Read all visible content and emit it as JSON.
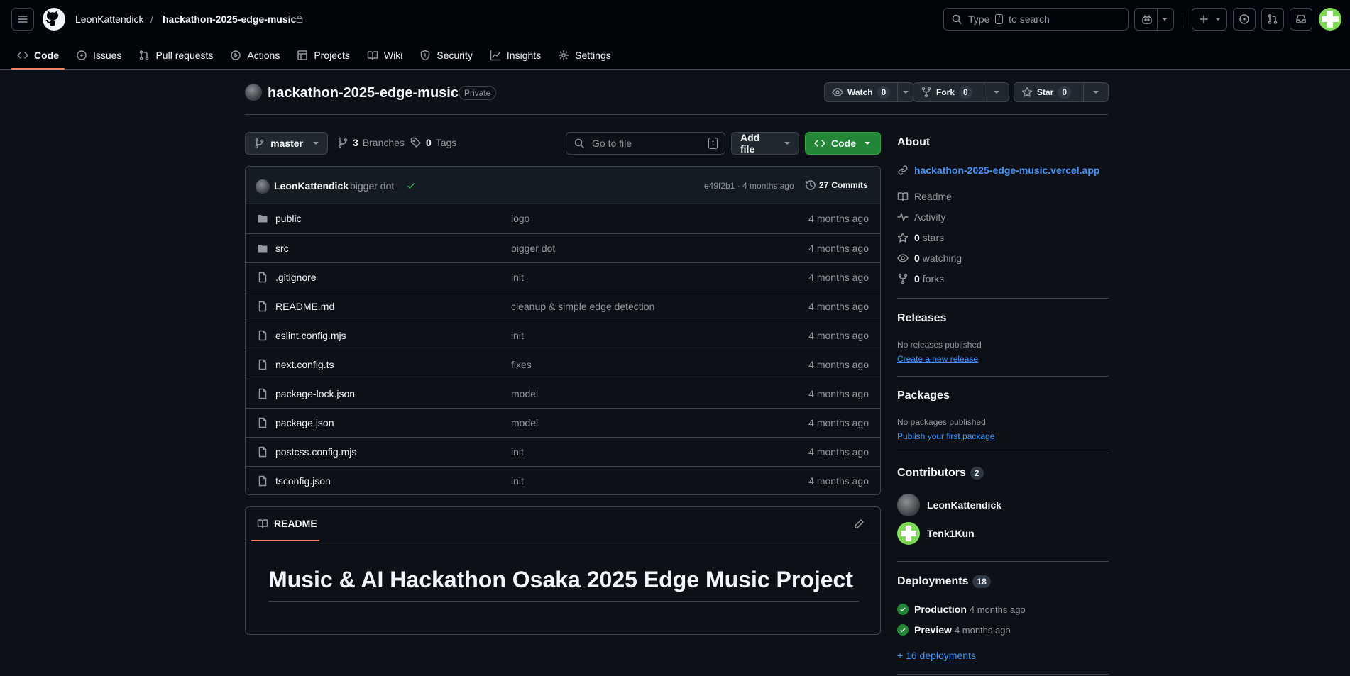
{
  "header": {
    "owner": "LeonKattendick",
    "separator": "/",
    "repo": "hackathon-2025-edge-music",
    "search_prefix": "Type",
    "search_key": "/",
    "search_suffix": "to search"
  },
  "tabs": [
    {
      "label": "Code",
      "icon": "code-icon"
    },
    {
      "label": "Issues",
      "icon": "issue-icon"
    },
    {
      "label": "Pull requests",
      "icon": "pull-request-icon"
    },
    {
      "label": "Actions",
      "icon": "play-icon"
    },
    {
      "label": "Projects",
      "icon": "table-icon"
    },
    {
      "label": "Wiki",
      "icon": "book-icon"
    },
    {
      "label": "Security",
      "icon": "shield-icon"
    },
    {
      "label": "Insights",
      "icon": "graph-icon"
    },
    {
      "label": "Settings",
      "icon": "gear-icon"
    }
  ],
  "repo": {
    "name": "hackathon-2025-edge-music",
    "visibility": "Private",
    "watch_label": "Watch",
    "watch_count": "0",
    "fork_label": "Fork",
    "fork_count": "0",
    "star_label": "Star",
    "star_count": "0"
  },
  "toolbar": {
    "branch": "master",
    "branches_count": "3",
    "branches_label": "Branches",
    "tags_count": "0",
    "tags_label": "Tags",
    "goto_placeholder": "Go to file",
    "goto_key": "t",
    "add_file": "Add file",
    "code": "Code"
  },
  "commit": {
    "author": "LeonKattendick",
    "message": "bigger dot",
    "hash_time": "e49f2b1 · 4 months ago",
    "commits_count": "27",
    "commits_label": "Commits"
  },
  "files": [
    {
      "name": "public",
      "type": "folder",
      "message": "logo",
      "date": "4 months ago"
    },
    {
      "name": "src",
      "type": "folder",
      "message": "bigger dot",
      "date": "4 months ago"
    },
    {
      "name": ".gitignore",
      "type": "file",
      "message": "init",
      "date": "4 months ago"
    },
    {
      "name": "README.md",
      "type": "file",
      "message": "cleanup & simple edge detection",
      "date": "4 months ago"
    },
    {
      "name": "eslint.config.mjs",
      "type": "file",
      "message": "init",
      "date": "4 months ago"
    },
    {
      "name": "next.config.ts",
      "type": "file",
      "message": "fixes",
      "date": "4 months ago"
    },
    {
      "name": "package-lock.json",
      "type": "file",
      "message": "model",
      "date": "4 months ago"
    },
    {
      "name": "package.json",
      "type": "file",
      "message": "model",
      "date": "4 months ago"
    },
    {
      "name": "postcss.config.mjs",
      "type": "file",
      "message": "init",
      "date": "4 months ago"
    },
    {
      "name": "tsconfig.json",
      "type": "file",
      "message": "init",
      "date": "4 months ago"
    }
  ],
  "readme": {
    "tab": "README",
    "heading": "Music & AI Hackathon Osaka 2025 Edge Music Project"
  },
  "about": {
    "title": "About",
    "website": "hackathon-2025-edge-music.vercel.app",
    "readme": "Readme",
    "activity": "Activity",
    "stars_count": "0",
    "stars_label": "stars",
    "watching_count": "0",
    "watching_label": "watching",
    "forks_count": "0",
    "forks_label": "forks"
  },
  "releases": {
    "title": "Releases",
    "empty": "No releases published",
    "create": "Create a new release"
  },
  "packages": {
    "title": "Packages",
    "empty": "No packages published",
    "publish": "Publish your first package"
  },
  "contributors": {
    "title": "Contributors",
    "count": "2",
    "people": [
      "LeonKattendick",
      "Tenk1Kun"
    ]
  },
  "deployments": {
    "title": "Deployments",
    "count": "18",
    "items": [
      {
        "name": "Production",
        "time": "4 months ago"
      },
      {
        "name": "Preview",
        "time": "4 months ago"
      }
    ],
    "more": "+ 16 deployments"
  },
  "colors": {
    "bg": "#0d1117",
    "header_bg": "#010409",
    "border": "#3d444d",
    "accent_tab": "#f78166",
    "green": "#238636",
    "link": "#4493f8",
    "muted": "#9198a1"
  }
}
